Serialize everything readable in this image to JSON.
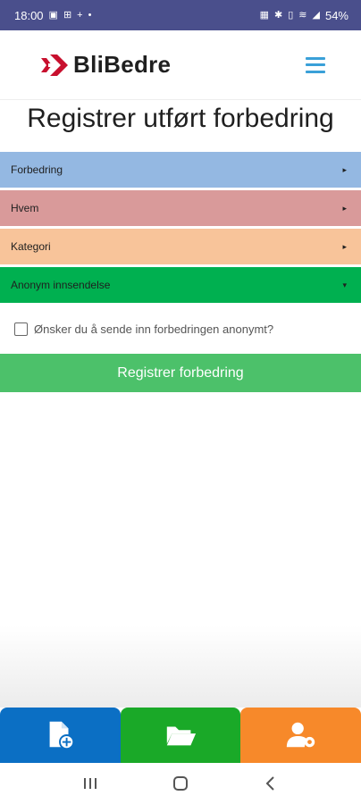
{
  "status_bar": {
    "time": "18:00",
    "battery": "54%",
    "left_icons": [
      "gallery-icon",
      "sim-icon",
      "plus-icon",
      "dot-icon"
    ],
    "right_icons": [
      "nfc-icon",
      "bluetooth-icon",
      "vibrate-icon",
      "wifi-icon",
      "signal-icon"
    ]
  },
  "header": {
    "logo_text": "BliBedre",
    "brand_color": "#c8102e",
    "menu_icon": "hamburger-icon",
    "menu_color": "#3aa0d8"
  },
  "page": {
    "title": "Registrer utført forbedring"
  },
  "accordion": {
    "items": [
      {
        "label": "Forbedring",
        "color": "#94b8e2",
        "arrow": "▸"
      },
      {
        "label": "Hvem",
        "color": "#d99a9a",
        "arrow": "▸"
      },
      {
        "label": "Kategori",
        "color": "#f8c49a",
        "arrow": "▸"
      },
      {
        "label": "Anonym innsendelse",
        "color": "#00b050",
        "arrow": "▾"
      }
    ]
  },
  "anonymous": {
    "question": "Ønsker du å sende inn forbedringen anonymt?",
    "checked": false
  },
  "submit": {
    "label": "Registrer forbedring",
    "color": "#4cc16a"
  },
  "bottom_nav": {
    "tabs": [
      {
        "icon": "new-document-icon",
        "color": "#0b6fc4"
      },
      {
        "icon": "open-folder-icon",
        "color": "#1aa928"
      },
      {
        "icon": "user-settings-icon",
        "color": "#f7892a"
      }
    ]
  },
  "system_nav": {
    "buttons": [
      "recent-apps-icon",
      "home-icon",
      "back-icon"
    ]
  }
}
